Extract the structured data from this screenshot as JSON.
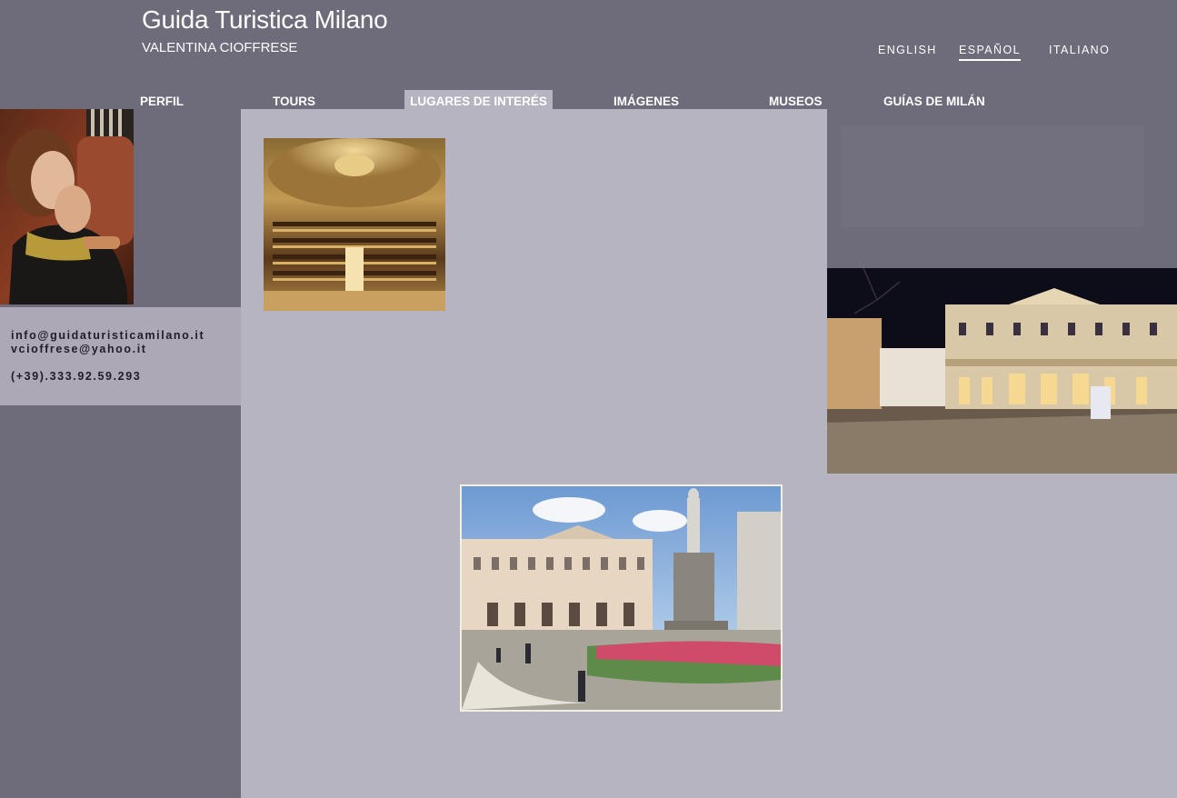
{
  "header": {
    "title": "Guida Turistica Milano",
    "subtitle": "VALENTINA CIOFFRESE"
  },
  "languages": {
    "english": "ENGLISH",
    "espanol": "ESPAÑOL",
    "italiano": "ITALIANO",
    "active": "espanol"
  },
  "nav": {
    "perfil": "PERFIL",
    "tours": "TOURS",
    "lugares": "LUGARES DE INTERÉS",
    "imagenes": "IMÁGENES",
    "museos": "MUSEOS",
    "guias": "GUÍAS DE MILÁN",
    "active": "lugares"
  },
  "contact": {
    "email1": "info@guidaturisticamilano.it",
    "email2": "vcioffrese@yahoo.it",
    "phone": "(+39).333.92.59.293"
  },
  "colors": {
    "background": "#6e6b7a",
    "content_panel": "#b7b4c1",
    "contact_box": "#aca8b6",
    "text_light": "#ffffff",
    "text_dark": "#1f1d27"
  }
}
